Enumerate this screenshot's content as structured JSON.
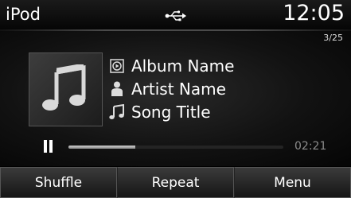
{
  "status": {
    "source_label": "iPod",
    "clock": "12:05",
    "usb_icon": "usb-icon"
  },
  "track_counter": "3/25",
  "track": {
    "album": "Album Name",
    "artist": "Artist Name",
    "song": "Song Title",
    "album_icon": "album-icon",
    "artist_icon": "artist-icon",
    "song_icon": "music-note-icon",
    "artwork_icon": "music-note-icon"
  },
  "playback": {
    "state_icon": "pause-icon",
    "elapsed": "02:21",
    "progress_fraction": 0.31
  },
  "softkeys": [
    {
      "label": "Shuffle"
    },
    {
      "label": "Repeat"
    },
    {
      "label": "Menu"
    }
  ],
  "colors": {
    "background": "#000000",
    "text": "#ffffff",
    "elapsed_text": "#8c8c8c",
    "progress_fill": "#b0b0b0"
  }
}
